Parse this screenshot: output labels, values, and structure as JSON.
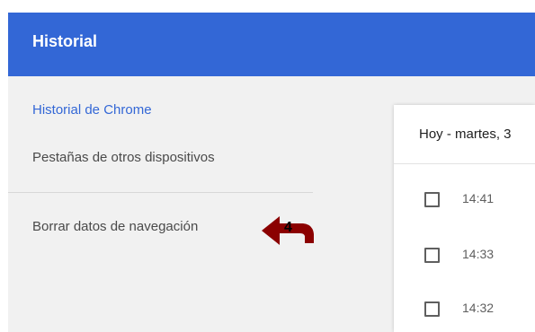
{
  "header": {
    "title": "Historial",
    "color": "#3367d6"
  },
  "sidebar": {
    "items": [
      {
        "label": "Historial de Chrome",
        "active": true
      },
      {
        "label": "Pestañas de otros dispositivos",
        "active": false
      },
      {
        "label": "Borrar datos de navegación",
        "active": false
      }
    ]
  },
  "annotation": {
    "number": "4",
    "icon": "arrow-left-icon",
    "color": "#8b0000"
  },
  "history": {
    "date_header": "Hoy - martes, 3",
    "entries": [
      {
        "time": "14:41"
      },
      {
        "time": "14:33"
      },
      {
        "time": "14:32"
      }
    ]
  }
}
